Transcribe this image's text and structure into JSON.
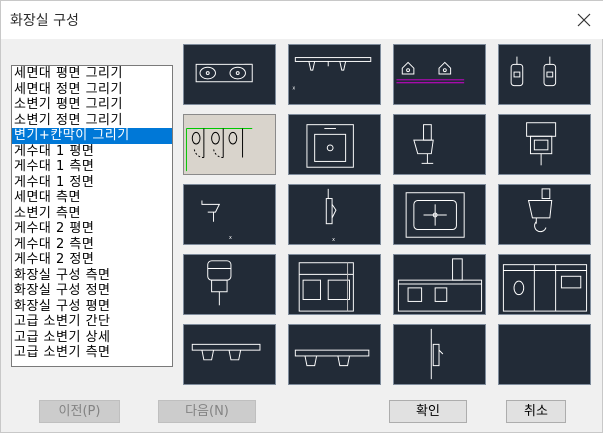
{
  "window": {
    "title": "화장실 구성"
  },
  "list": {
    "items": [
      "세면대 평면 그리기",
      "세면대 정면 그리기",
      "소변기 평면 그리기",
      "소변기 정면 그리기",
      "변기+칸막이 그리기",
      "게수대 1 평면",
      "게수대 1 측면",
      "게수대 1 정면",
      "세면대 측면",
      "소변기 측면",
      "게수대 2 평면",
      "게수대 2 측면",
      "게수대 2 정면",
      "화장실 구성 측면",
      "화장실 구성 정면",
      "화장실 구성 평면",
      "고급 소변기 간단",
      "고급 소변기 상세",
      "고급 소변기 측면"
    ],
    "selected_index": 4
  },
  "buttons": {
    "prev": "이전(P)",
    "next": "다음(N)",
    "ok": "확인",
    "cancel": "취소"
  },
  "colors": {
    "selection": "#0078d7",
    "thumb_bg": "#222b37",
    "thumb_selected_bg": "#d9d4cc"
  }
}
